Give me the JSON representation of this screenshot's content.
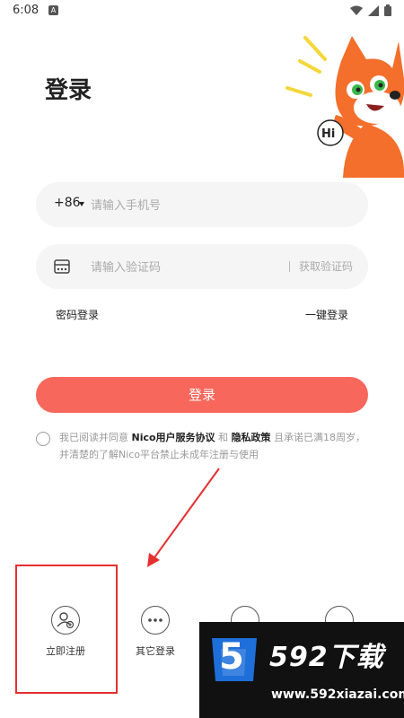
{
  "status_bar": {
    "time": "6:08",
    "app_badge": "A"
  },
  "title": "登录",
  "mascot": {
    "greeting": "Hi"
  },
  "phone": {
    "country_code": "+86",
    "placeholder": "请输入手机号"
  },
  "code": {
    "placeholder": "请输入验证码",
    "get_code_label": "获取验证码"
  },
  "links": {
    "password_login": "密码登录",
    "onekey_login": "一键登录"
  },
  "login_button": "登录",
  "agreement": {
    "prefix": "我已阅读并同意",
    "terms": "Nico用户服务协议",
    "and": "和",
    "privacy": "隐私政策",
    "suffix": "且承诺已满18周岁，并清楚的了解Nico平台禁止未成年注册与使用"
  },
  "bottom": {
    "register_label": "立即注册",
    "other_login_label": "其它登录"
  },
  "watermark": {
    "brand": "592下载",
    "url": "www.592xiazai.com",
    "digit": "5"
  },
  "colors": {
    "accent": "#f8675b",
    "annotation": "#e53030"
  }
}
